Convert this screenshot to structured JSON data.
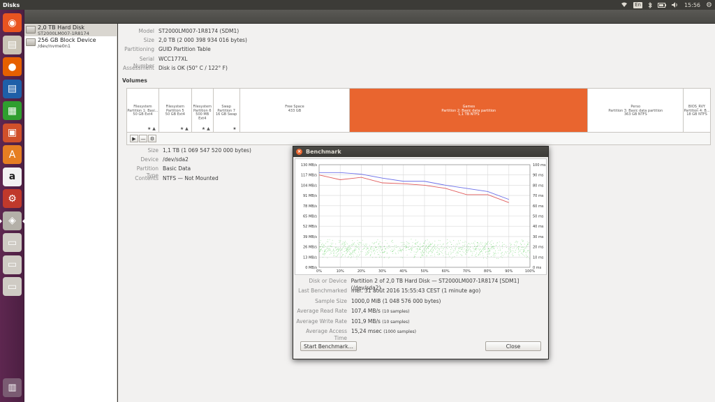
{
  "window": {
    "title": "Disks"
  },
  "top_panel": {
    "keyboard": "En",
    "time": "15:56",
    "icons": [
      "wifi-icon",
      "keyboard-indicator",
      "bluetooth-icon",
      "battery-icon",
      "volume-icon",
      "clock",
      "gear-icon"
    ]
  },
  "launcher": {
    "items": [
      {
        "name": "ubuntu-dash-icon",
        "glyph": "◉",
        "bg": "#e95420"
      },
      {
        "name": "files-icon",
        "glyph": "▤",
        "bg": "#c9c3b5"
      },
      {
        "name": "firefox-icon",
        "glyph": "●",
        "bg": "#e66000"
      },
      {
        "name": "writer-icon",
        "glyph": "▤",
        "bg": "#1e5fa8"
      },
      {
        "name": "calc-icon",
        "glyph": "▦",
        "bg": "#2f9e2f"
      },
      {
        "name": "impress-icon",
        "glyph": "▣",
        "bg": "#d0502a"
      },
      {
        "name": "software-center-icon",
        "glyph": "A",
        "bg": "#e67e22"
      },
      {
        "name": "amazon-icon",
        "glyph": "a",
        "bg": "#f2f2f2"
      },
      {
        "name": "system-settings-icon",
        "glyph": "⚙",
        "bg": "#c0392b"
      },
      {
        "name": "disks-icon",
        "glyph": "◈",
        "bg": "#b4b0a8"
      },
      {
        "name": "drive-icon-1",
        "glyph": "▭",
        "bg": "#cfcbc4"
      },
      {
        "name": "drive-icon-2",
        "glyph": "▭",
        "bg": "#cfcbc4"
      },
      {
        "name": "drive-icon-3",
        "glyph": "▭",
        "bg": "#cfcbc4"
      }
    ],
    "trash": {
      "name": "trash-icon",
      "glyph": "🗑"
    }
  },
  "devices": [
    {
      "name": "2,0 TB Hard Disk",
      "sub": "ST2000LM007-1R8174",
      "selected": true
    },
    {
      "name": "256 GB Block Device",
      "sub": "/dev/nvme0n1",
      "selected": false
    }
  ],
  "disk_info": {
    "model_k": "Model",
    "model": "ST2000LM007-1R8174 (SDM1)",
    "size_k": "Size",
    "size": "2,0 TB (2 000 398 934 016 bytes)",
    "partitioning_k": "Partitioning",
    "partitioning": "GUID Partition Table",
    "serial_k": "Serial Number",
    "serial": "WCC177XL",
    "assessment_k": "Assessment",
    "assessment": "Disk is OK (50° C / 122° F)"
  },
  "volumes_heading": "Volumes",
  "volumes": [
    {
      "l1": "Filesystem",
      "l2": "Partition 1: Basi...",
      "l3": "50 GB Ext4",
      "star": "★ ▲"
    },
    {
      "l1": "Filesystem",
      "l2": "Partition 5",
      "l3": "50 GB Ext4",
      "star": "★ ▲"
    },
    {
      "l1": "Filesystem",
      "l2": "Partition 6",
      "l3": "500 MB Ext4",
      "star": "★ ▲"
    },
    {
      "l1": "Swap",
      "l2": "Partition 7",
      "l3": "16 GB Swap",
      "star": "★"
    },
    {
      "l1": "Free Space",
      "l2": "433 GB",
      "l3": "",
      "star": ""
    },
    {
      "l1": "Games",
      "l2": "Partition 2: Basic data partition",
      "l3": "1,1 TB NTFS",
      "star": ""
    },
    {
      "l1": "Perso",
      "l2": "Partition 3: Basic data partition",
      "l3": "363 GB NTFS",
      "star": ""
    },
    {
      "l1": "BIOS_RVY",
      "l2": "Partition 4: B...",
      "l3": "18 GB NTFS",
      "star": ""
    }
  ],
  "volume_tools": [
    "▶",
    "—",
    "⚙"
  ],
  "partition_info": {
    "size_k": "Size",
    "size": "1,1 TB (1 069 547 520 000 bytes)",
    "device_k": "Device",
    "device": "/dev/sda2",
    "type_k": "Partition Type",
    "type": "Basic Data",
    "contents_k": "Contents",
    "contents": "NTFS — Not Mounted"
  },
  "benchmark": {
    "title": "Benchmark",
    "disk_k": "Disk or Device",
    "disk": "Partition 2 of 2,0 TB Hard Disk — ST2000LM007-1R8174 [SDM1] (/dev/sda2)",
    "last_k": "Last Benchmarked",
    "last": "mer. 31 août 2016 15:55:43 CEST (1 minute ago)",
    "sample_k": "Sample Size",
    "sample": "1000,0 MiB (1 048 576 000 bytes)",
    "read_k": "Average Read Rate",
    "read": "107,4 MB/s",
    "read_s": "(10 samples)",
    "write_k": "Average Write Rate",
    "write": "101,9 MB/s",
    "write_s": "(10 samples)",
    "access_k": "Average Access Time",
    "access": "15,24 msec",
    "access_s": "(1000 samples)",
    "start_label": "Start Benchmark…",
    "close_label": "Close"
  },
  "chart_data": {
    "type": "line",
    "x": [
      0,
      10,
      20,
      30,
      40,
      50,
      60,
      70,
      80,
      90
    ],
    "xticks": [
      "0%",
      "10%",
      "20%",
      "30%",
      "40%",
      "50%",
      "60%",
      "70%",
      "80%",
      "90%",
      "100%"
    ],
    "yticks_left": [
      "0 MB/s",
      "13 MB/s",
      "26 MB/s",
      "39 MB/s",
      "52 MB/s",
      "65 MB/s",
      "78 MB/s",
      "91 MB/s",
      "104 MB/s",
      "117 MB/s",
      "130 MB/s"
    ],
    "yticks_right": [
      "0 ms",
      "10 ms",
      "20 ms",
      "30 ms",
      "40 ms",
      "50 ms",
      "60 ms",
      "70 ms",
      "80 ms",
      "90 ms",
      "100 ms"
    ],
    "ylim_left": [
      0,
      130
    ],
    "ylim_right": [
      0,
      100
    ],
    "grid": true,
    "series": [
      {
        "color": "#6a6ee8",
        "values": [
          120,
          120,
          118,
          113,
          109,
          109,
          104,
          100,
          96,
          86
        ]
      },
      {
        "color": "#e05a5a",
        "values": [
          117,
          111,
          114,
          107,
          106,
          104,
          100,
          92,
          92,
          82
        ]
      }
    ],
    "scatter": {
      "color": "#44c844",
      "ylim_ms": [
        8,
        28
      ]
    }
  }
}
